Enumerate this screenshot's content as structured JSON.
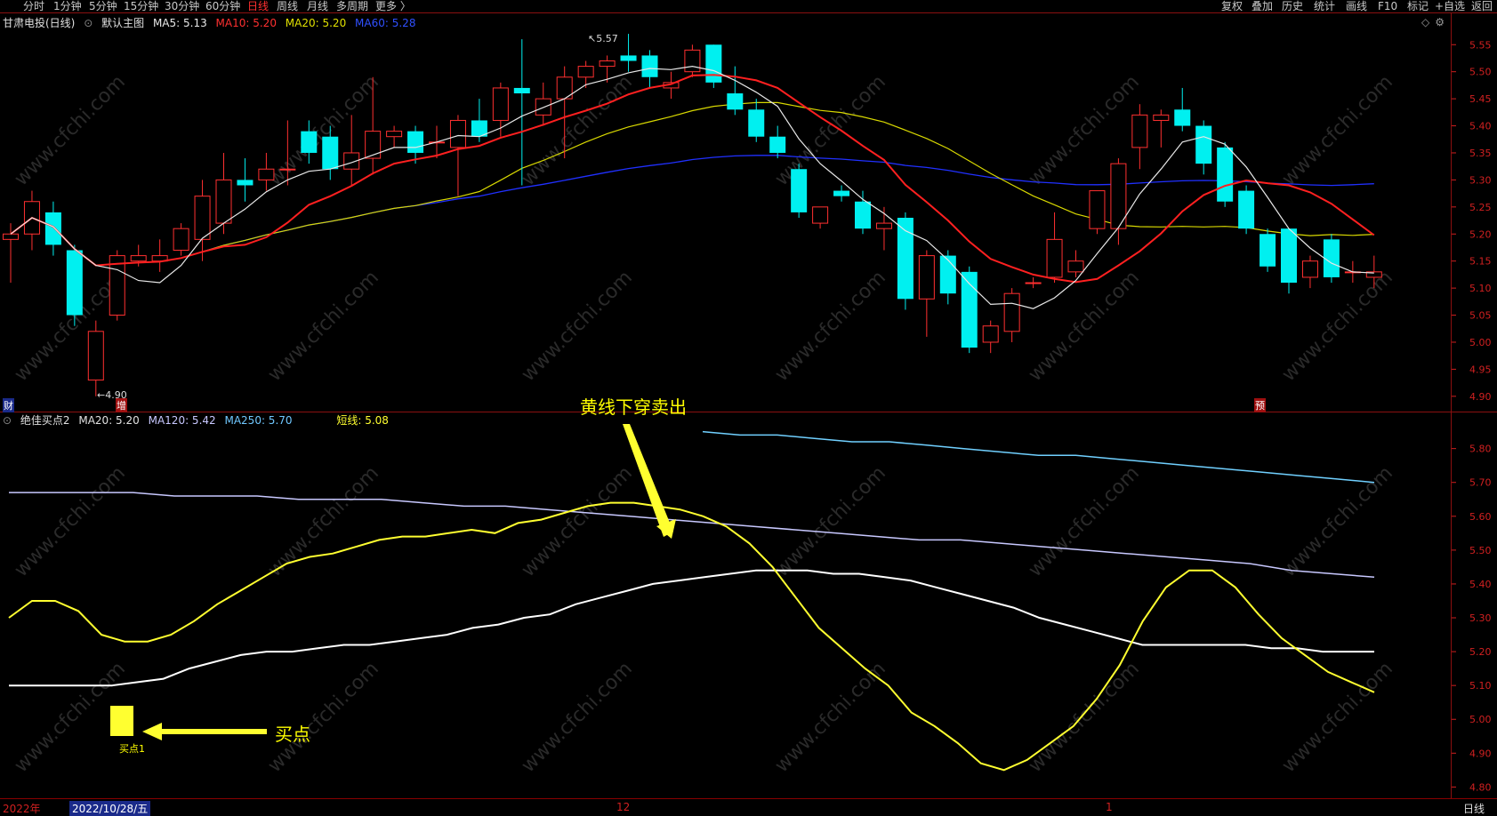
{
  "toolbar": {
    "left_items": [
      "分时",
      "1分钟",
      "5分钟",
      "15分钟",
      "30分钟",
      "60分钟",
      "日线",
      "周线",
      "月线",
      "多周期",
      "更多 〉"
    ],
    "active": "日线",
    "right_items": [
      "复权",
      "叠加",
      "历史",
      "统计",
      "画线",
      "F10",
      "标记",
      "+自选",
      "返回"
    ]
  },
  "main_legend": {
    "stock": "甘肃电投(日线)",
    "template": "默认主图",
    "ma5": "MA5: 5.13",
    "ma10": "MA10: 5.20",
    "ma20": "MA20: 5.20",
    "ma60": "MA60: 5.28"
  },
  "sub_legend": {
    "name": "绝佳买点2",
    "ma20": "MA20: 5.20",
    "ma120": "MA120: 5.42",
    "ma250": "MA250: 5.70",
    "short": "短线: 5.08"
  },
  "main_axis_ticks": [
    "5.55",
    "5.50",
    "5.45",
    "5.40",
    "5.35",
    "5.30",
    "5.25",
    "5.20",
    "5.15",
    "5.10",
    "5.05",
    "5.00",
    "4.95",
    "4.90"
  ],
  "sub_axis_ticks": [
    "5.80",
    "5.70",
    "5.60",
    "5.50",
    "5.40",
    "5.30",
    "5.20",
    "5.10",
    "5.00",
    "4.90",
    "4.80"
  ],
  "main_labels": {
    "high": "5.57",
    "low": "←4.90",
    "cai": "财",
    "zeng": "增",
    "yu": "预"
  },
  "annotations": {
    "sell": "黄线下穿卖出",
    "buy": "买点",
    "buy_marker": "买点1"
  },
  "bottom": {
    "year": "2022年",
    "date": "2022/10/28/五",
    "m12": "12",
    "m1": "1",
    "period": "日线"
  },
  "watermark": "www.cfchi.com",
  "colors": {
    "up": "#ff3030",
    "down": "#00f0f0",
    "ma5": "#e8e8e8",
    "ma10": "#ff2020",
    "ma20": "#d8d800",
    "ma60": "#2030ff",
    "short": "#ffff30",
    "ma120": "#c8c8ff",
    "ma250": "#70d0ff",
    "axis": "#d02020"
  },
  "chart_data": [
    {
      "type": "candlestick",
      "title": "甘肃电投(日线)",
      "ylim": [
        4.88,
        5.58
      ],
      "candles": [
        {
          "o": 5.19,
          "c": 5.2,
          "h": 5.22,
          "l": 5.11
        },
        {
          "o": 5.2,
          "c": 5.26,
          "h": 5.28,
          "l": 5.17
        },
        {
          "o": 5.24,
          "c": 5.18,
          "h": 5.26,
          "l": 5.16
        },
        {
          "o": 5.17,
          "c": 5.05,
          "h": 5.18,
          "l": 5.03
        },
        {
          "o": 4.93,
          "c": 5.02,
          "h": 5.04,
          "l": 4.9
        },
        {
          "o": 5.05,
          "c": 5.16,
          "h": 5.17,
          "l": 5.04
        },
        {
          "o": 5.15,
          "c": 5.16,
          "h": 5.18,
          "l": 5.14
        },
        {
          "o": 5.15,
          "c": 5.16,
          "h": 5.19,
          "l": 5.13
        },
        {
          "o": 5.17,
          "c": 5.21,
          "h": 5.22,
          "l": 5.16
        },
        {
          "o": 5.19,
          "c": 5.27,
          "h": 5.3,
          "l": 5.15
        },
        {
          "o": 5.22,
          "c": 5.3,
          "h": 5.35,
          "l": 5.2
        },
        {
          "o": 5.3,
          "c": 5.29,
          "h": 5.34,
          "l": 5.26
        },
        {
          "o": 5.3,
          "c": 5.32,
          "h": 5.35,
          "l": 5.28
        },
        {
          "o": 5.32,
          "c": 5.32,
          "h": 5.41,
          "l": 5.29
        },
        {
          "o": 5.39,
          "c": 5.35,
          "h": 5.41,
          "l": 5.33
        },
        {
          "o": 5.38,
          "c": 5.32,
          "h": 5.4,
          "l": 5.3
        },
        {
          "o": 5.32,
          "c": 5.35,
          "h": 5.42,
          "l": 5.29
        },
        {
          "o": 5.34,
          "c": 5.39,
          "h": 5.49,
          "l": 5.31
        },
        {
          "o": 5.38,
          "c": 5.39,
          "h": 5.4,
          "l": 5.36
        },
        {
          "o": 5.39,
          "c": 5.35,
          "h": 5.4,
          "l": 5.33
        },
        {
          "o": 5.37,
          "c": 5.37,
          "h": 5.4,
          "l": 5.34
        },
        {
          "o": 5.36,
          "c": 5.41,
          "h": 5.42,
          "l": 5.27
        },
        {
          "o": 5.41,
          "c": 5.38,
          "h": 5.45,
          "l": 5.37
        },
        {
          "o": 5.41,
          "c": 5.47,
          "h": 5.48,
          "l": 5.38
        },
        {
          "o": 5.47,
          "c": 5.46,
          "h": 5.56,
          "l": 5.29
        },
        {
          "o": 5.42,
          "c": 5.45,
          "h": 5.48,
          "l": 5.4
        },
        {
          "o": 5.45,
          "c": 5.49,
          "h": 5.51,
          "l": 5.34
        },
        {
          "o": 5.49,
          "c": 5.51,
          "h": 5.52,
          "l": 5.47
        },
        {
          "o": 5.51,
          "c": 5.52,
          "h": 5.53,
          "l": 5.48
        },
        {
          "o": 5.53,
          "c": 5.52,
          "h": 5.57,
          "l": 5.5
        },
        {
          "o": 5.53,
          "c": 5.49,
          "h": 5.54,
          "l": 5.47
        },
        {
          "o": 5.47,
          "c": 5.48,
          "h": 5.5,
          "l": 5.45
        },
        {
          "o": 5.5,
          "c": 5.54,
          "h": 5.55,
          "l": 5.49
        },
        {
          "o": 5.55,
          "c": 5.48,
          "h": 5.55,
          "l": 5.47
        },
        {
          "o": 5.46,
          "c": 5.43,
          "h": 5.51,
          "l": 5.42
        },
        {
          "o": 5.43,
          "c": 5.38,
          "h": 5.45,
          "l": 5.37
        },
        {
          "o": 5.38,
          "c": 5.35,
          "h": 5.4,
          "l": 5.34
        },
        {
          "o": 5.32,
          "c": 5.24,
          "h": 5.33,
          "l": 5.23
        },
        {
          "o": 5.22,
          "c": 5.25,
          "h": 5.25,
          "l": 5.21
        },
        {
          "o": 5.28,
          "c": 5.27,
          "h": 5.29,
          "l": 5.26
        },
        {
          "o": 5.26,
          "c": 5.21,
          "h": 5.28,
          "l": 5.2
        },
        {
          "o": 5.21,
          "c": 5.22,
          "h": 5.25,
          "l": 5.17
        },
        {
          "o": 5.23,
          "c": 5.08,
          "h": 5.24,
          "l": 5.06
        },
        {
          "o": 5.08,
          "c": 5.16,
          "h": 5.17,
          "l": 5.01
        },
        {
          "o": 5.16,
          "c": 5.09,
          "h": 5.17,
          "l": 5.07
        },
        {
          "o": 5.13,
          "c": 4.99,
          "h": 5.14,
          "l": 4.98
        },
        {
          "o": 5.0,
          "c": 5.03,
          "h": 5.04,
          "l": 4.98
        },
        {
          "o": 5.02,
          "c": 5.09,
          "h": 5.1,
          "l": 5.0
        },
        {
          "o": 5.11,
          "c": 5.11,
          "h": 5.12,
          "l": 5.1
        },
        {
          "o": 5.12,
          "c": 5.19,
          "h": 5.24,
          "l": 5.11
        },
        {
          "o": 5.13,
          "c": 5.15,
          "h": 5.17,
          "l": 5.12
        },
        {
          "o": 5.21,
          "c": 5.28,
          "h": 5.28,
          "l": 5.2
        },
        {
          "o": 5.21,
          "c": 5.33,
          "h": 5.34,
          "l": 5.18
        },
        {
          "o": 5.36,
          "c": 5.42,
          "h": 5.44,
          "l": 5.32
        },
        {
          "o": 5.41,
          "c": 5.42,
          "h": 5.43,
          "l": 5.36
        },
        {
          "o": 5.43,
          "c": 5.4,
          "h": 5.47,
          "l": 5.39
        },
        {
          "o": 5.4,
          "c": 5.33,
          "h": 5.41,
          "l": 5.31
        },
        {
          "o": 5.36,
          "c": 5.26,
          "h": 5.37,
          "l": 5.25
        },
        {
          "o": 5.28,
          "c": 5.21,
          "h": 5.29,
          "l": 5.2
        },
        {
          "o": 5.2,
          "c": 5.14,
          "h": 5.21,
          "l": 5.13
        },
        {
          "o": 5.21,
          "c": 5.11,
          "h": 5.21,
          "l": 5.09
        },
        {
          "o": 5.12,
          "c": 5.15,
          "h": 5.16,
          "l": 5.1
        },
        {
          "o": 5.19,
          "c": 5.12,
          "h": 5.2,
          "l": 5.11
        },
        {
          "o": 5.13,
          "c": 5.13,
          "h": 5.15,
          "l": 5.11
        },
        {
          "o": 5.12,
          "c": 5.13,
          "h": 5.16,
          "l": 5.1
        }
      ]
    },
    {
      "type": "line",
      "title": "绝佳买点2",
      "ylim": [
        4.78,
        5.87
      ],
      "series": [
        {
          "name": "短线",
          "values": [
            5.3,
            5.35,
            5.35,
            5.32,
            5.25,
            5.23,
            5.23,
            5.25,
            5.29,
            5.34,
            5.38,
            5.42,
            5.46,
            5.48,
            5.49,
            5.51,
            5.53,
            5.54,
            5.54,
            5.55,
            5.56,
            5.55,
            5.58,
            5.59,
            5.61,
            5.63,
            5.64,
            5.64,
            5.63,
            5.62,
            5.6,
            5.57,
            5.52,
            5.45,
            5.36,
            5.27,
            5.21,
            5.15,
            5.1,
            5.02,
            4.98,
            4.93,
            4.87,
            4.85,
            4.88,
            4.93,
            4.98,
            5.06,
            5.16,
            5.29,
            5.39,
            5.44,
            5.44,
            5.39,
            5.31,
            5.24,
            5.19,
            5.14,
            5.11,
            5.08
          ]
        },
        {
          "name": "MA20",
          "values": [
            5.1,
            5.1,
            5.1,
            5.1,
            5.1,
            5.11,
            5.12,
            5.15,
            5.17,
            5.19,
            5.2,
            5.2,
            5.21,
            5.22,
            5.22,
            5.23,
            5.24,
            5.25,
            5.27,
            5.28,
            5.3,
            5.31,
            5.34,
            5.36,
            5.38,
            5.4,
            5.41,
            5.42,
            5.43,
            5.44,
            5.44,
            5.44,
            5.43,
            5.43,
            5.42,
            5.41,
            5.39,
            5.37,
            5.35,
            5.33,
            5.3,
            5.28,
            5.26,
            5.24,
            5.22,
            5.22,
            5.22,
            5.22,
            5.22,
            5.21,
            5.21,
            5.2,
            5.2,
            5.2
          ]
        },
        {
          "name": "MA120",
          "values": [
            5.67,
            5.67,
            5.67,
            5.67,
            5.66,
            5.66,
            5.66,
            5.65,
            5.65,
            5.65,
            5.64,
            5.63,
            5.63,
            5.62,
            5.61,
            5.6,
            5.59,
            5.58,
            5.57,
            5.56,
            5.55,
            5.54,
            5.53,
            5.53,
            5.52,
            5.51,
            5.5,
            5.49,
            5.48,
            5.47,
            5.46,
            5.44,
            5.43,
            5.42
          ]
        },
        {
          "name": "MA250",
          "values": [
            5.85,
            5.84,
            5.84,
            5.83,
            5.82,
            5.82,
            5.81,
            5.8,
            5.79,
            5.78,
            5.78,
            5.77,
            5.76,
            5.75,
            5.74,
            5.73,
            5.72,
            5.71,
            5.7
          ]
        }
      ]
    }
  ]
}
